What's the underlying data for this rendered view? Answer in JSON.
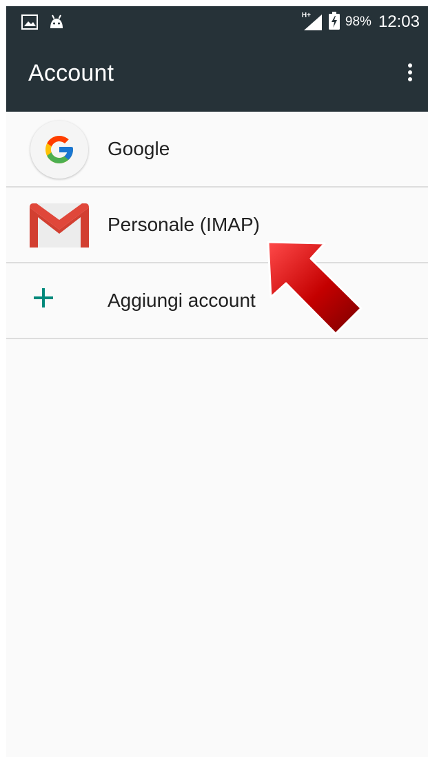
{
  "status_bar": {
    "network_label": "H+",
    "battery_percent": "98%",
    "time": "12:03",
    "left_icons": [
      "image-icon",
      "android-icon"
    ],
    "right_icons": [
      "signal-icon",
      "battery-charging-icon"
    ]
  },
  "app_bar": {
    "title": "Account",
    "menu_icon": "more-vert-icon"
  },
  "accounts": [
    {
      "label": "Google",
      "icon": "google-icon"
    },
    {
      "label": "Personale (IMAP)",
      "icon": "gmail-icon"
    }
  ],
  "add_account": {
    "label": "Aggiungi account",
    "icon": "plus-icon"
  },
  "colors": {
    "app_bar_bg": "#263238",
    "background": "#fafafa",
    "divider": "#dddddd",
    "accent": "#00897b",
    "annotation_arrow": "#c40000"
  }
}
